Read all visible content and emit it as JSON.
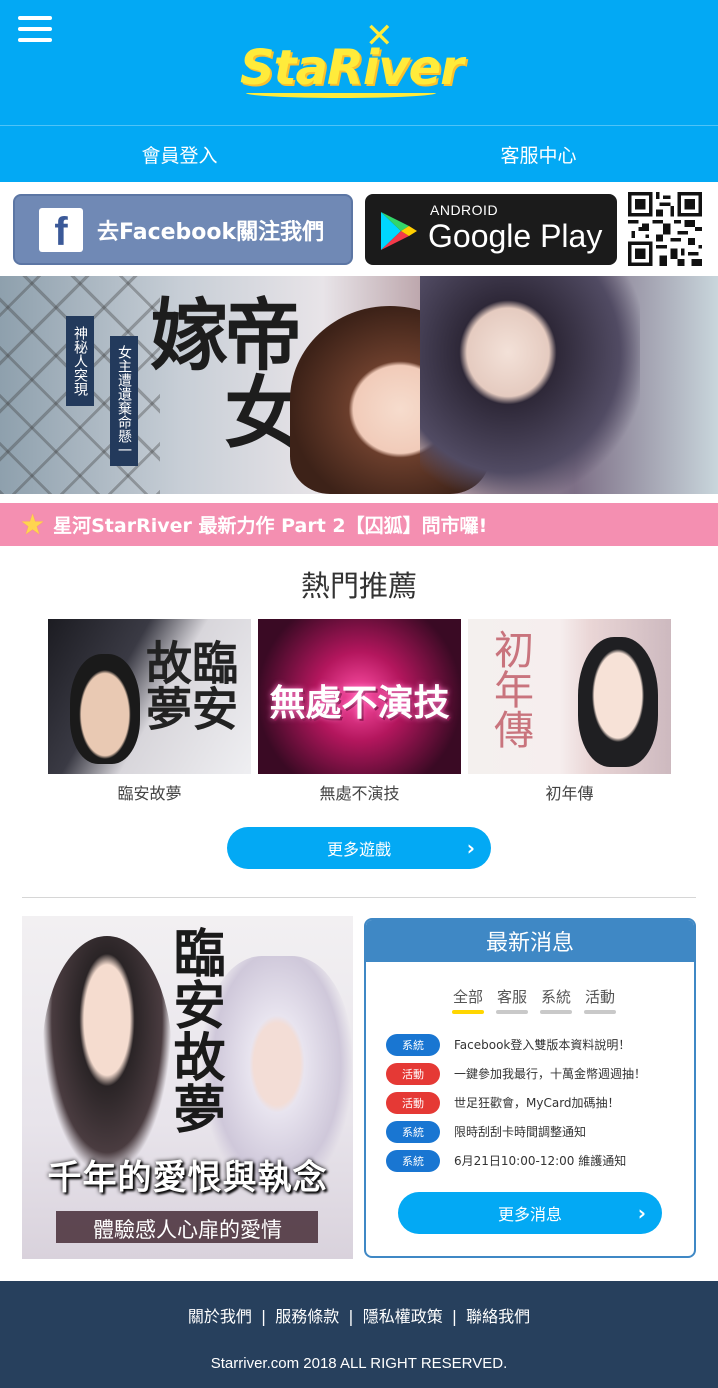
{
  "header": {
    "logo_text": "StaRiver",
    "nav": [
      "會員登入",
      "客服中心"
    ]
  },
  "social": {
    "facebook_label": "去Facebook關注我們",
    "facebook_icon": "f",
    "google_small": "ANDROID",
    "google_big": "Google Play"
  },
  "banner": {
    "title": "帝女嫁",
    "tag1": "神秘人突現",
    "tag2": "女主遭遺棄命懸一"
  },
  "announce": {
    "text": "星河StarRiver 最新力作 Part 2【囚狐】問市囉!"
  },
  "hot": {
    "title": "熱門推薦",
    "games": [
      {
        "name": "臨安故夢",
        "art": "臨安故夢"
      },
      {
        "name": "無處不演技",
        "art": "無處不演技"
      },
      {
        "name": "初年傳",
        "art": "初年傳"
      }
    ],
    "more_label": "更多遊戲"
  },
  "promo": {
    "art_title": "臨安故夢",
    "line1": "千年的愛恨與執念",
    "line2": "體驗感人心扉的愛情"
  },
  "news": {
    "title": "最新消息",
    "tabs": [
      "全部",
      "客服",
      "系統",
      "活動"
    ],
    "items": [
      {
        "badge": "系統",
        "type": "sys",
        "text": "Facebook登入雙版本資料說明！"
      },
      {
        "badge": "活動",
        "type": "act",
        "text": "一鍵參加我最行，十萬金幣週週抽！"
      },
      {
        "badge": "活動",
        "type": "act",
        "text": "世足狂歡會，MyCard加碼抽！"
      },
      {
        "badge": "系統",
        "type": "sys",
        "text": "限時刮刮卡時間調整通知"
      },
      {
        "badge": "系統",
        "type": "sys",
        "text": "6月21日10:00-12:00 維護通知"
      }
    ],
    "more_label": "更多消息"
  },
  "footer": {
    "links": [
      "關於我們",
      "服務條款",
      "隱私權政策",
      "聯絡我們"
    ],
    "separator": "|",
    "copyright": "Starriver.com 2018 ALL RIGHT RESERVED."
  },
  "colors": {
    "primary": "#03a9f4",
    "announce": "#f48fb1",
    "news_blue": "#3f88c5",
    "footer": "#27405d",
    "badge_system": "#1976d2",
    "badge_activity": "#e53935"
  }
}
